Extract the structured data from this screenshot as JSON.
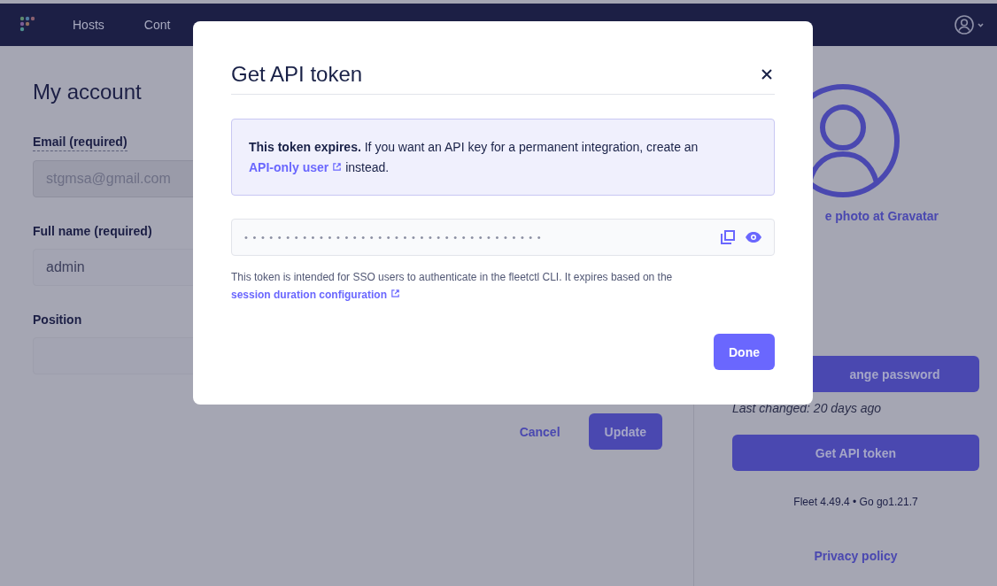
{
  "nav": {
    "items": [
      {
        "label": "Hosts"
      },
      {
        "label": "Cont"
      }
    ]
  },
  "page": {
    "title": "My account",
    "fields": [
      {
        "label": "Email (required)",
        "value": "stgmsa@gmail.com",
        "disabled": true,
        "has_tooltip": true
      },
      {
        "label": "Full name (required)",
        "value": "admin",
        "disabled": false,
        "has_tooltip": false
      },
      {
        "label": "Position",
        "disabled": false,
        "has_tooltip": false
      }
    ],
    "actions": {
      "cancel": "Cancel",
      "update": "Update"
    }
  },
  "sidebar": {
    "gravatar_link": "e photo at Gravatar",
    "change_password": "ange password",
    "last_changed": "Last changed: 20 days ago",
    "get_api_token": "Get API token",
    "version": "Fleet 4.49.4 • Go go1.21.7",
    "privacy": "Privacy policy"
  },
  "modal": {
    "title": "Get API token",
    "notice": {
      "before": "**This token expires.** If you want an API key for a permanent integration, create an ",
      "link": "API-only user",
      "after": " instead."
    },
    "token": {
      "masked_value": "••••••••••••••••••••••••••••••••••••"
    },
    "help": {
      "before": "This token is intended for SSO users to authenticate in the fleetctl CLI. It expires based on the ",
      "link": "session duration configuration"
    },
    "done": "Done"
  }
}
